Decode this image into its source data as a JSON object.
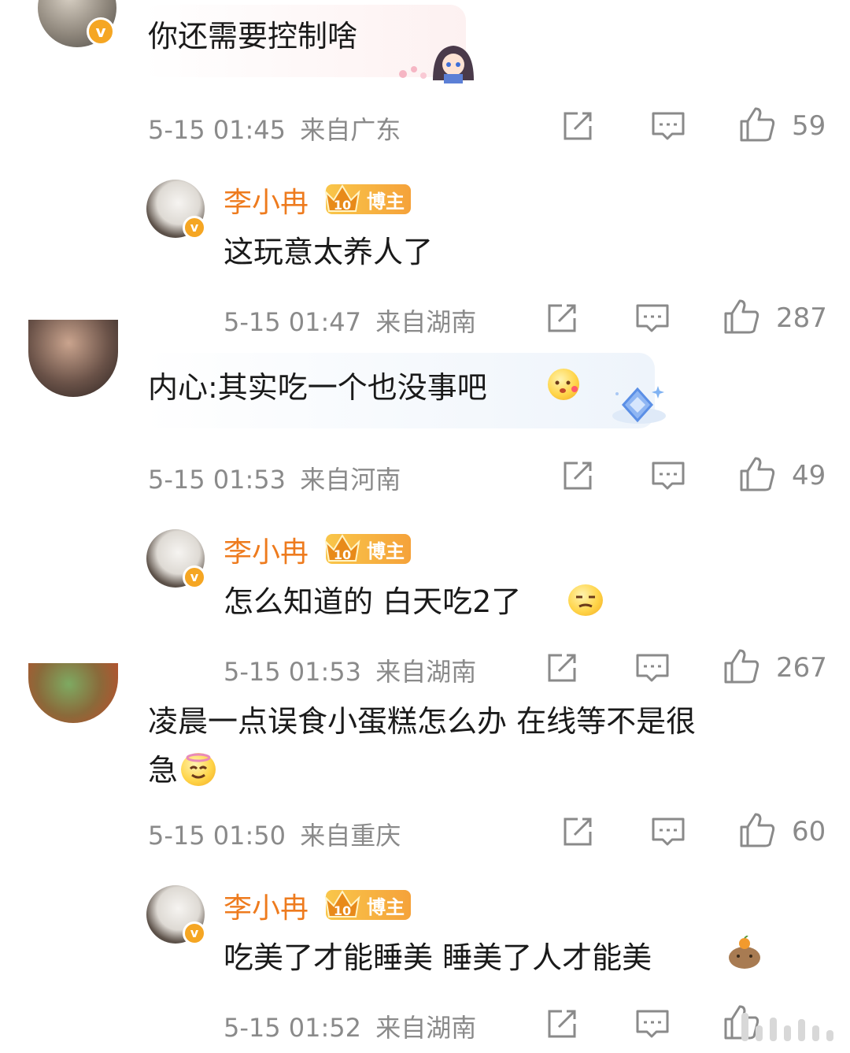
{
  "comments": [
    {
      "text": "你还需要控制啥",
      "time": "5-15 01:45",
      "location": "来自广东",
      "likes": "59",
      "reply": {
        "name": "李小冉",
        "badge": "博主",
        "text": "这玩意太养人了",
        "time": "5-15 01:47",
        "location": "来自湖南",
        "likes": "287"
      }
    },
    {
      "text": "内心:其实吃一个也没事吧",
      "time": "5-15 01:53",
      "location": "来自河南",
      "likes": "49",
      "reply": {
        "name": "李小冉",
        "badge": "博主",
        "text": "怎么知道的 白天吃2了",
        "time": "5-15 01:53",
        "location": "来自湖南",
        "likes": "267"
      }
    },
    {
      "text_line1": "凌晨一点误食小蛋糕怎么办 在线等不是很",
      "text_line2": "急",
      "time": "5-15 01:50",
      "location": "来自重庆",
      "likes": "60",
      "reply": {
        "name": "李小冉",
        "badge": "博主",
        "text": "吃美了才能睡美 睡美了人才能美",
        "time": "5-15 01:52",
        "location": "来自湖南"
      }
    }
  ],
  "icons": [
    "share-icon",
    "comment-icon",
    "like-icon",
    "verified-v-icon",
    "crown-level-icon"
  ],
  "badge_level": "10",
  "colors": {
    "name_orange": "#ee7b1e",
    "meta_gray": "#8a8a8a",
    "verified": "#f5a623"
  }
}
